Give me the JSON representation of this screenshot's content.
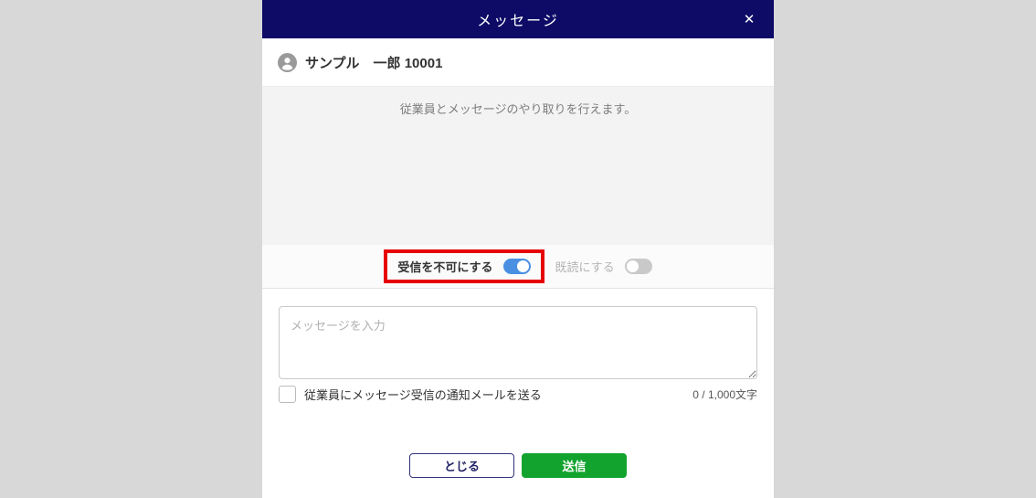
{
  "modal": {
    "title": "メッセージ",
    "close_icon": "✕",
    "user": {
      "display_name": "サンプル　一郎 10001"
    },
    "conversation": {
      "empty_text": "従業員とメッセージのやり取りを行えます。"
    },
    "toggle_bar": {
      "block_toggle": {
        "label": "受信を不可にする",
        "state": "on"
      },
      "read_toggle": {
        "label": "既読にする",
        "state": "off"
      }
    },
    "composer": {
      "placeholder": "メッセージを入力",
      "value": "",
      "notify_label": "従業員にメッセージ受信の通知メールを送る",
      "notify_checked": false,
      "char_counter": "0 / 1,000文字"
    },
    "footer": {
      "close_label": "とじる",
      "send_label": "送信"
    }
  },
  "annotation": {
    "type": "highlight-box",
    "target": "block_toggle",
    "color": "#e60000"
  },
  "colors": {
    "page_background": "#d8d8d8",
    "header_background": "#0d0b66",
    "conversation_background": "#f3f3f3",
    "toggle_on": "#4a90e2",
    "toggle_off": "#c9c9c9",
    "send_button": "#12a32e",
    "close_button_border": "#32327e",
    "annotation_red": "#e60000"
  }
}
